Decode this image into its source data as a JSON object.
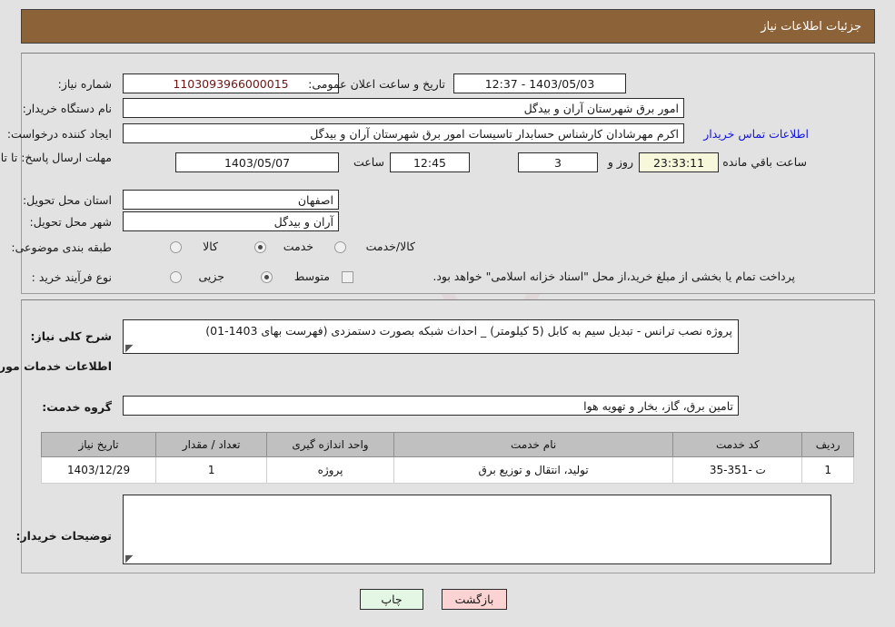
{
  "header": {
    "title": "جزئیات اطلاعات نیاز"
  },
  "watermark": {
    "text": "AriaTender.net"
  },
  "form": {
    "need_number_label": "شماره نیاز:",
    "need_number_value": "1103093966000015",
    "announce_datetime_label": "تاریخ و ساعت اعلان عمومی:",
    "announce_datetime_value": "1403/05/03 - 12:37",
    "buyer_org_label": "نام دستگاه خریدار:",
    "buyer_org_value": "امور برق شهرستان آران و بیدگل",
    "creator_label": "ایجاد کننده درخواست:",
    "creator_value": "اکرم مهرشادان کارشناس حسابدار تاسیسات امور برق شهرستان آران و بیدگل",
    "buyer_contact_link": "اطلاعات تماس خریدار",
    "deadline_label": "مهلت ارسال پاسخ: تا تاریخ:",
    "deadline_date": "1403/05/07",
    "deadline_time_label": "ساعت",
    "deadline_time": "12:45",
    "days_value": "3",
    "days_suffix_label": "روز و",
    "countdown_value": "23:33:11",
    "countdown_suffix_label": "ساعت باقي مانده",
    "province_label": "استان محل تحویل:",
    "province_value": "اصفهان",
    "city_label": "شهر محل تحویل:",
    "city_value": "آران و بیدگل",
    "category_label": "طبقه بندی موضوعی:",
    "category_options": [
      {
        "label": "کالا",
        "selected": false
      },
      {
        "label": "خدمت",
        "selected": true
      },
      {
        "label": "کالا/خدمت",
        "selected": false
      }
    ],
    "process_type_label": "نوع فرآیند خرید :",
    "process_options": [
      {
        "label": "جزیی",
        "selected": false
      },
      {
        "label": "متوسط",
        "selected": true
      }
    ],
    "treasury_checkbox_label": "پرداخت تمام یا بخشی از مبلغ خرید،از محل \"اسناد خزانه اسلامی\" خواهد بود.",
    "treasury_checked": false
  },
  "body": {
    "general_desc_label": "شرح کلی نیاز:",
    "general_desc_value": "پروژه نصب ترانس - تبدیل سیم به کابل (5 کیلومتر) _ احداث شبکه بصورت دستمزدی (فهرست بهای 1403-01)",
    "services_section_title": "اطلاعات خدمات مورد نیاز",
    "service_group_label": "گروه خدمت:",
    "service_group_value": "تامین برق، گاز، بخار و تهویه هوا",
    "buyer_notes_label": "توضیحات خریدار:",
    "buyer_notes_value": ""
  },
  "table": {
    "columns": [
      "ردیف",
      "کد خدمت",
      "نام خدمت",
      "واحد اندازه گیری",
      "تعداد / مقدار",
      "تاریخ نیاز"
    ],
    "rows": [
      {
        "row_no": "1",
        "service_code": "ت -351-35",
        "service_name": "تولید، انتقال و توزیع برق",
        "unit": "پروژه",
        "quantity": "1",
        "need_date": "1403/12/29"
      }
    ]
  },
  "footer": {
    "print_label": "چاپ",
    "back_label": "بازگشت"
  },
  "colors": {
    "header_bg": "#8c6239",
    "page_bg": "#e2e2e2",
    "link": "#1414e0",
    "accent_maroon": "#6e1414",
    "print_btn": "#e4f6e4",
    "back_btn": "#fbd3d3",
    "countdown_bg": "#f7f7dc"
  }
}
